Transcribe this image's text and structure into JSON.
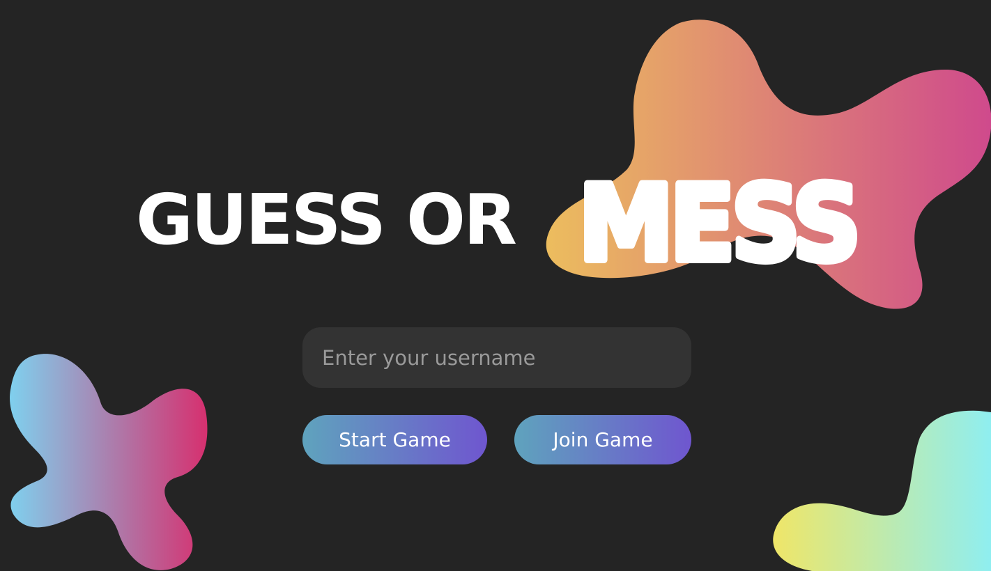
{
  "title": {
    "plain": "GUESS OR",
    "accent": "MESS"
  },
  "username": {
    "placeholder": "Enter your username",
    "value": ""
  },
  "buttons": {
    "start": "Start Game",
    "join": "Join Game"
  },
  "colors": {
    "background": "#242424",
    "input_background": "#333333",
    "button_gradient_start": "#5fa3bd",
    "button_gradient_end": "#6f56cf",
    "blob_top_right_start": "#ecbd5e",
    "blob_top_right_end": "#cf4a8c",
    "blob_bottom_left_start": "#7fd0ee",
    "blob_bottom_left_end": "#d6306f",
    "blob_bottom_right_start": "#efe668",
    "blob_bottom_right_end": "#8feef0"
  }
}
